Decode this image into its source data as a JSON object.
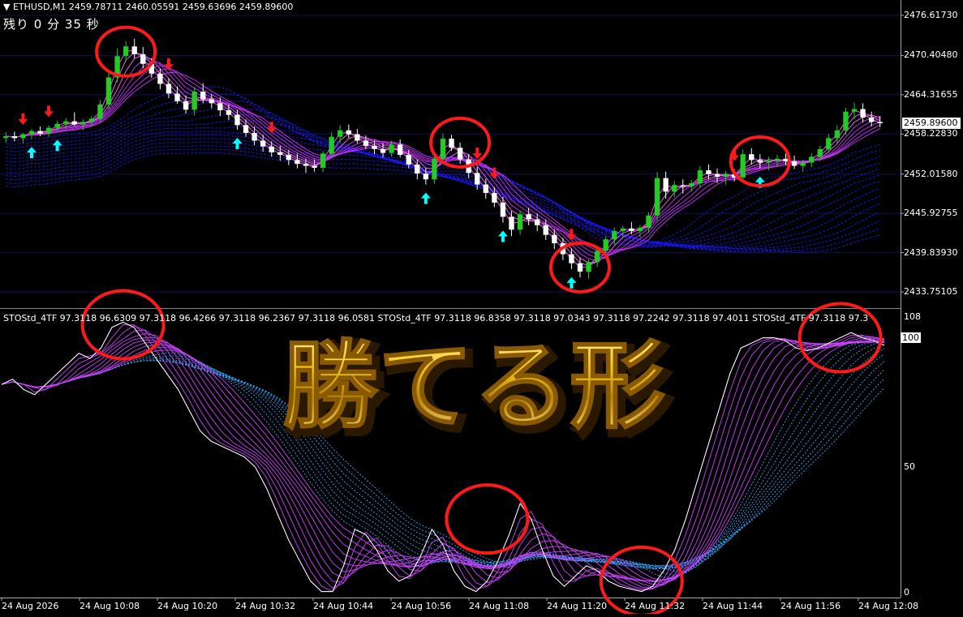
{
  "window": {
    "symbol_info": "ETHUSD,M1  2459.78711 2460.05591 2459.63696 2459.89600",
    "timer": "残り 0 分 35 秒"
  },
  "price_axis": {
    "ticks": [
      "2476.61730",
      "2470.40480",
      "2464.31655",
      "2458.22830",
      "2452.01580",
      "2445.92755",
      "2439.83930",
      "2433.75105"
    ],
    "current_price": "2459.89600"
  },
  "oscillator": {
    "header": "STOStd_4TF 97.3118 96.6309 97.3118 96.4266 97.3118 96.2367 97.3118 96.0581  STOStd_4TF 97.3118 96.8358 97.3118 97.0343 97.3118 97.2242 97.3118 97.4011  STOStd_4TF 97.3118 97.3",
    "ticks": [
      "108",
      "100",
      "50",
      "0"
    ]
  },
  "time_axis": {
    "labels": [
      "24 Aug 2026",
      "24 Aug 10:08",
      "24 Aug 10:20",
      "24 Aug 10:32",
      "24 Aug 10:44",
      "24 Aug 10:56",
      "24 Aug 11:08",
      "24 Aug 11:20",
      "24 Aug 11:32",
      "24 Aug 11:44",
      "24 Aug 11:56",
      "24 Aug 12:08"
    ]
  },
  "headline": "勝てる形",
  "colors": {
    "bull": "#22cc22",
    "bear": "#ffffff",
    "band_ribbon": "#1a1aff",
    "ma_ribbon": "#cc33ff",
    "stoch_ribbon_blue": "#33aaff",
    "stoch_ribbon_purple": "#cc44ff",
    "buy_arrow": "#00ffff",
    "sell_arrow": "#ff1a1a",
    "circle": "#ff1a1a",
    "gold": "#f5c518"
  },
  "chart_data": [
    {
      "type": "candlestick",
      "title": "ETHUSD,M1",
      "ylim": [
        2431.5,
        2479.0
      ],
      "ohlc": [
        [
          2457.6,
          2458.5,
          2456.9,
          2457.9
        ],
        [
          2457.9,
          2458.6,
          2457.1,
          2457.6
        ],
        [
          2457.6,
          2458.4,
          2456.8,
          2458.2
        ],
        [
          2458.2,
          2459.0,
          2457.5,
          2458.7
        ],
        [
          2458.7,
          2459.4,
          2457.9,
          2458.3
        ],
        [
          2458.3,
          2459.6,
          2457.8,
          2459.2
        ],
        [
          2459.2,
          2460.3,
          2458.6,
          2459.8
        ],
        [
          2459.8,
          2460.7,
          2459.0,
          2460.2
        ],
        [
          2460.2,
          2461.6,
          2459.5,
          2459.7
        ],
        [
          2459.7,
          2460.5,
          2458.8,
          2460.1
        ],
        [
          2460.1,
          2461.0,
          2459.4,
          2460.6
        ],
        [
          2460.6,
          2463.5,
          2460.0,
          2462.8
        ],
        [
          2462.8,
          2467.9,
          2462.1,
          2467.0
        ],
        [
          2467.0,
          2471.5,
          2466.2,
          2470.3
        ],
        [
          2470.3,
          2472.6,
          2469.4,
          2471.8
        ],
        [
          2471.8,
          2473.0,
          2470.0,
          2470.6
        ],
        [
          2470.6,
          2471.7,
          2468.4,
          2469.1
        ],
        [
          2469.1,
          2470.0,
          2466.9,
          2467.6
        ],
        [
          2467.6,
          2468.4,
          2465.2,
          2466.0
        ],
        [
          2466.0,
          2466.9,
          2463.8,
          2464.5
        ],
        [
          2464.5,
          2465.6,
          2462.9,
          2463.3
        ],
        [
          2463.3,
          2464.2,
          2461.4,
          2462.0
        ],
        [
          2462.0,
          2465.5,
          2461.1,
          2464.8
        ],
        [
          2464.8,
          2466.1,
          2463.0,
          2463.6
        ],
        [
          2463.6,
          2464.4,
          2462.2,
          2463.0
        ],
        [
          2463.0,
          2463.9,
          2461.0,
          2461.9
        ],
        [
          2461.9,
          2462.8,
          2460.4,
          2461.2
        ],
        [
          2461.2,
          2462.0,
          2458.9,
          2459.6
        ],
        [
          2459.6,
          2460.5,
          2457.8,
          2458.4
        ],
        [
          2458.4,
          2459.4,
          2456.5,
          2457.2
        ],
        [
          2457.2,
          2458.1,
          2455.5,
          2456.3
        ],
        [
          2456.3,
          2457.1,
          2454.7,
          2455.4
        ],
        [
          2455.4,
          2456.4,
          2454.1,
          2455.0
        ],
        [
          2455.0,
          2455.8,
          2453.4,
          2454.2
        ],
        [
          2454.2,
          2455.2,
          2452.9,
          2453.6
        ],
        [
          2453.6,
          2454.4,
          2452.2,
          2453.3
        ],
        [
          2453.3,
          2454.3,
          2452.4,
          2453.0
        ],
        [
          2453.0,
          2455.6,
          2452.3,
          2455.2
        ],
        [
          2455.2,
          2458.5,
          2454.6,
          2457.8
        ],
        [
          2457.8,
          2459.6,
          2456.9,
          2458.8
        ],
        [
          2458.8,
          2459.7,
          2457.6,
          2458.2
        ],
        [
          2458.2,
          2459.0,
          2456.8,
          2457.2
        ],
        [
          2457.2,
          2458.0,
          2455.9,
          2456.4
        ],
        [
          2456.4,
          2457.2,
          2455.1,
          2455.9
        ],
        [
          2455.9,
          2456.8,
          2454.6,
          2455.3
        ],
        [
          2455.3,
          2457.2,
          2454.7,
          2456.6
        ],
        [
          2456.6,
          2457.4,
          2454.6,
          2455.0
        ],
        [
          2455.0,
          2455.8,
          2452.9,
          2453.5
        ],
        [
          2453.5,
          2454.3,
          2451.2,
          2452.1
        ],
        [
          2452.1,
          2453.0,
          2450.4,
          2451.2
        ],
        [
          2451.2,
          2455.0,
          2450.5,
          2454.4
        ],
        [
          2454.4,
          2458.3,
          2453.7,
          2457.5
        ],
        [
          2457.5,
          2458.1,
          2455.6,
          2456.1
        ],
        [
          2456.1,
          2456.9,
          2453.6,
          2454.3
        ],
        [
          2454.3,
          2455.1,
          2451.4,
          2452.2
        ],
        [
          2452.2,
          2453.1,
          2449.6,
          2450.4
        ],
        [
          2450.4,
          2451.3,
          2448.2,
          2449.1
        ],
        [
          2449.1,
          2450.0,
          2446.9,
          2447.6
        ],
        [
          2447.6,
          2448.5,
          2444.5,
          2445.4
        ],
        [
          2445.4,
          2446.3,
          2442.4,
          2443.4
        ],
        [
          2443.4,
          2446.4,
          2442.6,
          2445.8
        ],
        [
          2445.8,
          2446.8,
          2444.1,
          2445.0
        ],
        [
          2445.0,
          2445.9,
          2443.2,
          2444.1
        ],
        [
          2444.1,
          2445.0,
          2441.8,
          2442.6
        ],
        [
          2442.6,
          2443.5,
          2440.4,
          2441.3
        ],
        [
          2441.3,
          2442.1,
          2438.7,
          2439.6
        ],
        [
          2439.6,
          2440.5,
          2437.3,
          2438.2
        ],
        [
          2438.2,
          2439.1,
          2436.0,
          2436.9
        ],
        [
          2436.9,
          2438.8,
          2435.8,
          2438.4
        ],
        [
          2438.4,
          2440.6,
          2437.6,
          2440.1
        ],
        [
          2440.1,
          2442.4,
          2439.3,
          2441.9
        ],
        [
          2441.9,
          2443.8,
          2441.0,
          2443.2
        ],
        [
          2443.2,
          2444.0,
          2442.2,
          2443.6
        ],
        [
          2443.6,
          2444.6,
          2442.7,
          2443.2
        ],
        [
          2443.2,
          2444.1,
          2442.2,
          2443.7
        ],
        [
          2443.7,
          2446.1,
          2442.9,
          2445.6
        ],
        [
          2445.6,
          2452.3,
          2444.8,
          2451.4
        ],
        [
          2451.4,
          2452.4,
          2448.2,
          2449.3
        ],
        [
          2449.3,
          2451.0,
          2448.4,
          2450.3
        ],
        [
          2450.3,
          2451.2,
          2449.0,
          2450.1
        ],
        [
          2450.1,
          2451.1,
          2449.3,
          2450.6
        ],
        [
          2450.6,
          2453.2,
          2449.9,
          2452.6
        ],
        [
          2452.6,
          2453.5,
          2451.2,
          2452.0
        ],
        [
          2452.0,
          2452.9,
          2450.6,
          2451.6
        ],
        [
          2451.6,
          2452.5,
          2450.4,
          2452.0
        ],
        [
          2452.0,
          2452.8,
          2450.9,
          2451.5
        ],
        [
          2451.5,
          2455.8,
          2450.9,
          2455.1
        ],
        [
          2455.1,
          2456.0,
          2453.5,
          2454.2
        ],
        [
          2454.2,
          2455.1,
          2452.9,
          2453.8
        ],
        [
          2453.8,
          2454.7,
          2452.6,
          2454.1
        ],
        [
          2454.1,
          2455.0,
          2453.2,
          2454.4
        ],
        [
          2454.4,
          2455.2,
          2453.4,
          2454.0
        ],
        [
          2454.0,
          2454.9,
          2452.8,
          2453.3
        ],
        [
          2453.3,
          2454.2,
          2452.4,
          2453.8
        ],
        [
          2453.8,
          2455.3,
          2453.1,
          2454.7
        ],
        [
          2454.7,
          2456.4,
          2454.0,
          2455.9
        ],
        [
          2455.9,
          2458.2,
          2455.3,
          2457.6
        ],
        [
          2457.6,
          2459.6,
          2456.8,
          2458.8
        ],
        [
          2458.8,
          2462.3,
          2458.1,
          2461.7
        ],
        [
          2461.7,
          2463.1,
          2460.6,
          2462.1
        ],
        [
          2462.1,
          2463.0,
          2460.0,
          2460.8
        ],
        [
          2460.8,
          2461.7,
          2459.4,
          2460.1
        ],
        [
          2460.1,
          2461.0,
          2459.3,
          2459.9
        ]
      ],
      "buy_signals_at_candle": [
        3,
        6,
        27,
        49,
        58,
        66,
        88
      ],
      "sell_signals_at_candle": [
        2,
        5,
        19,
        31,
        55,
        57,
        66,
        85
      ]
    },
    {
      "type": "line",
      "title": "STOStd_4TF",
      "ylim": [
        0,
        108
      ],
      "ticks": [
        0,
        50,
        100,
        108
      ],
      "values": [
        82,
        84,
        80,
        78,
        82,
        86,
        90,
        94,
        92,
        96,
        104,
        106,
        104,
        98,
        92,
        86,
        80,
        72,
        64,
        60,
        58,
        56,
        54,
        50,
        42,
        32,
        22,
        14,
        6,
        2,
        2,
        12,
        26,
        24,
        18,
        10,
        6,
        8,
        16,
        26,
        20,
        10,
        4,
        2,
        6,
        14,
        24,
        36,
        30,
        18,
        8,
        4,
        8,
        12,
        10,
        6,
        4,
        3,
        2,
        4,
        10,
        18,
        30,
        44,
        58,
        72,
        86,
        96,
        98,
        100,
        100,
        99,
        96,
        95,
        96,
        98,
        100,
        102,
        100,
        99,
        97
      ]
    }
  ]
}
